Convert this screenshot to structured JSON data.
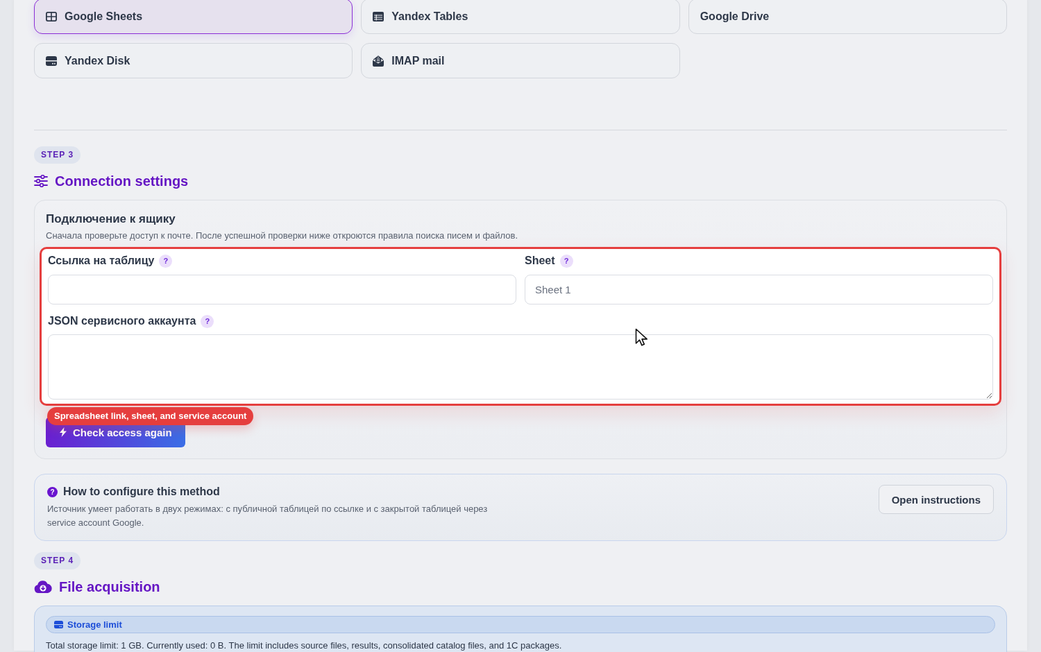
{
  "sources": [
    {
      "label": "Google Sheets",
      "kind": "spreadsheet",
      "selected": true
    },
    {
      "label": "Yandex Tables",
      "kind": "table",
      "selected": false
    },
    {
      "label": "Google Drive",
      "kind": "cloud",
      "selected": false
    },
    {
      "label": "Yandex Disk",
      "kind": "disk",
      "selected": false
    },
    {
      "label": "IMAP mail",
      "kind": "mail",
      "selected": false
    }
  ],
  "step3": {
    "badge": "STEP 3",
    "title": "Connection settings",
    "panel": {
      "title": "Подключение к ящику",
      "description": "Сначала проверьте доступ к почте. После успешной проверки ниже откроются правила поиска писем и файлов.",
      "invalid": true,
      "fields": [
        {
          "label": "Ссылка на таблицу",
          "help": "?",
          "kind": "input"
        },
        {
          "label": "Sheet",
          "help": "?",
          "kind": "input",
          "placeholder": "Sheet 1"
        },
        {
          "label": "JSON сервисного аккаунта",
          "help": "?",
          "kind": "textarea"
        }
      ],
      "error": "Spreadsheet link, sheet, and service account",
      "button": "Check access again"
    },
    "help": {
      "mark": "?",
      "title": "How to configure this method",
      "text": "Источник умеет работать в двух режимах: с публичной таблицей по ссылке и с закрытой таблицей через service account Google.",
      "button": "Open instructions"
    }
  },
  "step4": {
    "badge": "STEP 4",
    "title": "File acquisition",
    "storage": {
      "title": "Storage limit",
      "text": "Total storage limit: 1 GB. Currently used: 0 B. The limit includes source files, results, consolidated catalog files, and 1C packages."
    }
  }
}
